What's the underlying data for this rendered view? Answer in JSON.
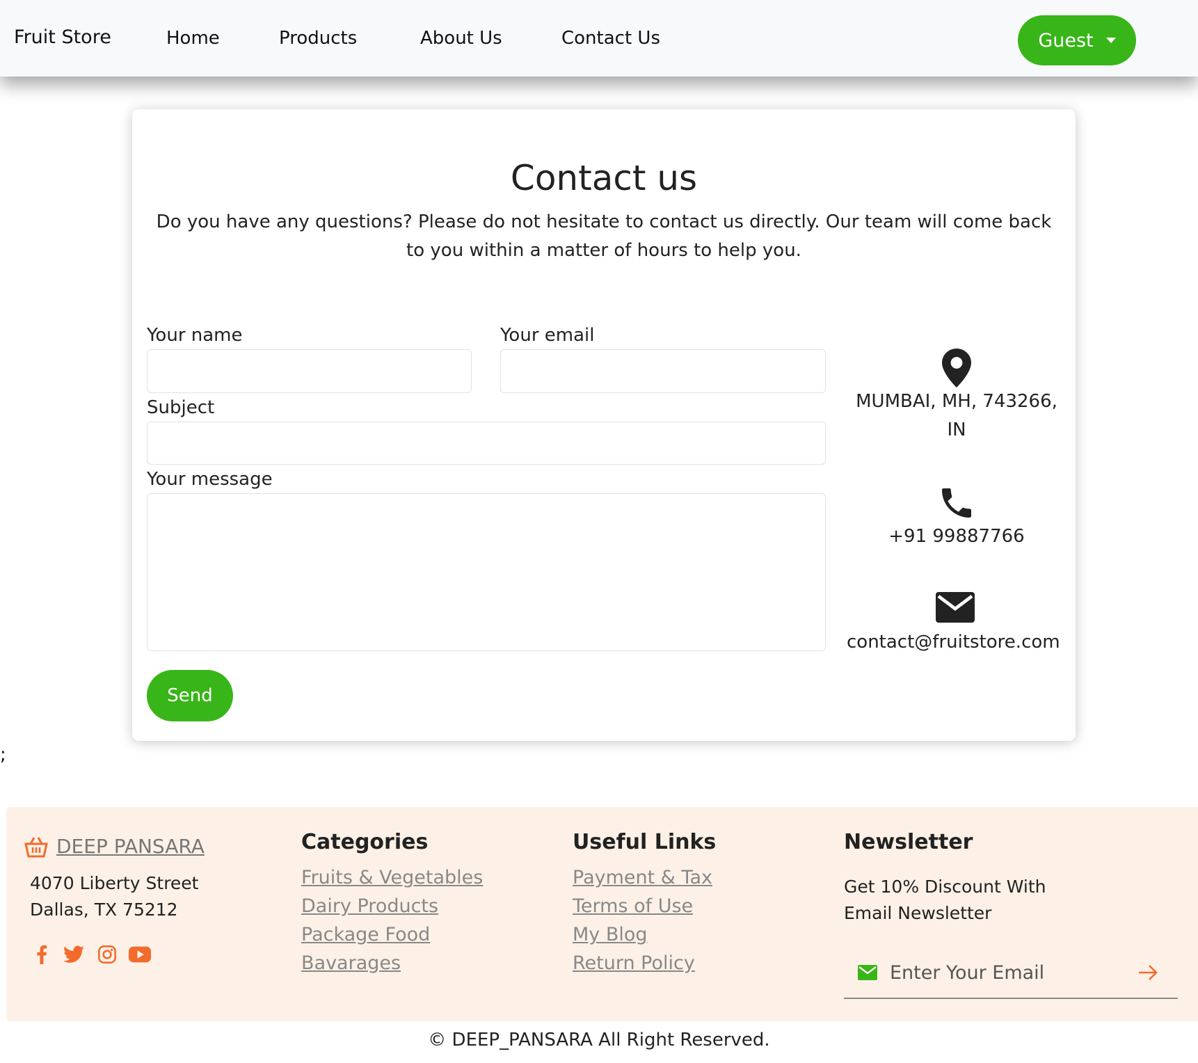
{
  "nav": {
    "brand": "Fruit Store",
    "links": [
      "Home",
      "Products",
      "About Us",
      "Contact Us"
    ],
    "guest_label": "Guest"
  },
  "contact": {
    "title": "Contact us",
    "lead": "Do you have any questions? Please do not hesitate to contact us directly. Our team will come back to you within a matter of hours to help you.",
    "labels": {
      "name": "Your name",
      "email": "Your email",
      "subject": "Subject",
      "message": "Your message"
    },
    "values": {
      "name": "",
      "email": "",
      "subject": "",
      "message": ""
    },
    "send_label": "Send",
    "address_line1": "MUMBAI, MH, 743266,",
    "address_line2": "IN",
    "phone": "+91 99887766",
    "email_address": "contact@fruitstore.com"
  },
  "stray_text": ";",
  "footer": {
    "brand": "DEEP PANSARA",
    "address_line1": "4070 Liberty Street",
    "address_line2": "Dallas, TX 75212",
    "social_icons": [
      "facebook-icon",
      "twitter-icon",
      "instagram-icon",
      "youtube-icon"
    ],
    "categories_title": "Categories",
    "categories": [
      "Fruits & Vegetables",
      "Dairy Products",
      "Package Food",
      "Bavarages"
    ],
    "useful_title": "Useful Links",
    "useful": [
      "Payment & Tax",
      "Terms of Use",
      "My Blog",
      "Return Policy"
    ],
    "newsletter_title": "Newsletter",
    "newsletter_line1": "Get 10% Discount With",
    "newsletter_line2": "Email Newsletter",
    "newsletter_placeholder": "Enter Your Email",
    "accent_color": "#f26b2d",
    "button_color": "#38b518"
  },
  "copyright": "© DEEP_PANSARA All Right Reserved."
}
